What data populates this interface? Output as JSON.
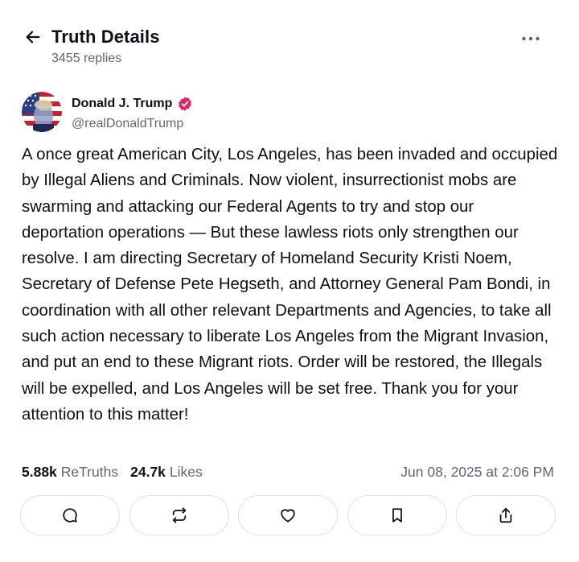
{
  "header": {
    "title": "Truth Details",
    "replies": "3455 replies",
    "back_icon": "arrow-left-icon",
    "more_icon": "more-horizontal-icon"
  },
  "post": {
    "author_name": "Donald J. Trump",
    "handle": "@realDonaldTrump",
    "verified_icon": "verified-badge-icon",
    "verified_color": "#e5245f",
    "body": "A once great American City, Los Angeles, has been invaded and occupied by Illegal Aliens and Criminals.  Now violent, insurrectionist mobs are swarming and attacking our Federal Agents to try and stop our deportation operations — But these lawless riots only strengthen our resolve. I am directing Secretary of Homeland Security Kristi Noem, Secretary of Defense Pete Hegseth, and Attorney General Pam Bondi, in coordination with all other relevant Departments and Agencies, to take all such action necessary to liberate Los Angeles from the Migrant Invasion, and put an end to these Migrant riots. Order will be restored, the Illegals will be expelled, and Los Angeles will be set free. Thank you for your attention to this matter!"
  },
  "stats": {
    "retruths_count": "5.88k",
    "retruths_label": "ReTruths",
    "likes_count": "24.7k",
    "likes_label": "Likes",
    "timestamp": "Jun 08, 2025 at 2:06 PM"
  },
  "actions": [
    {
      "icon": "reply-icon"
    },
    {
      "icon": "retruth-icon"
    },
    {
      "icon": "like-icon"
    },
    {
      "icon": "bookmark-icon"
    },
    {
      "icon": "share-icon"
    }
  ]
}
